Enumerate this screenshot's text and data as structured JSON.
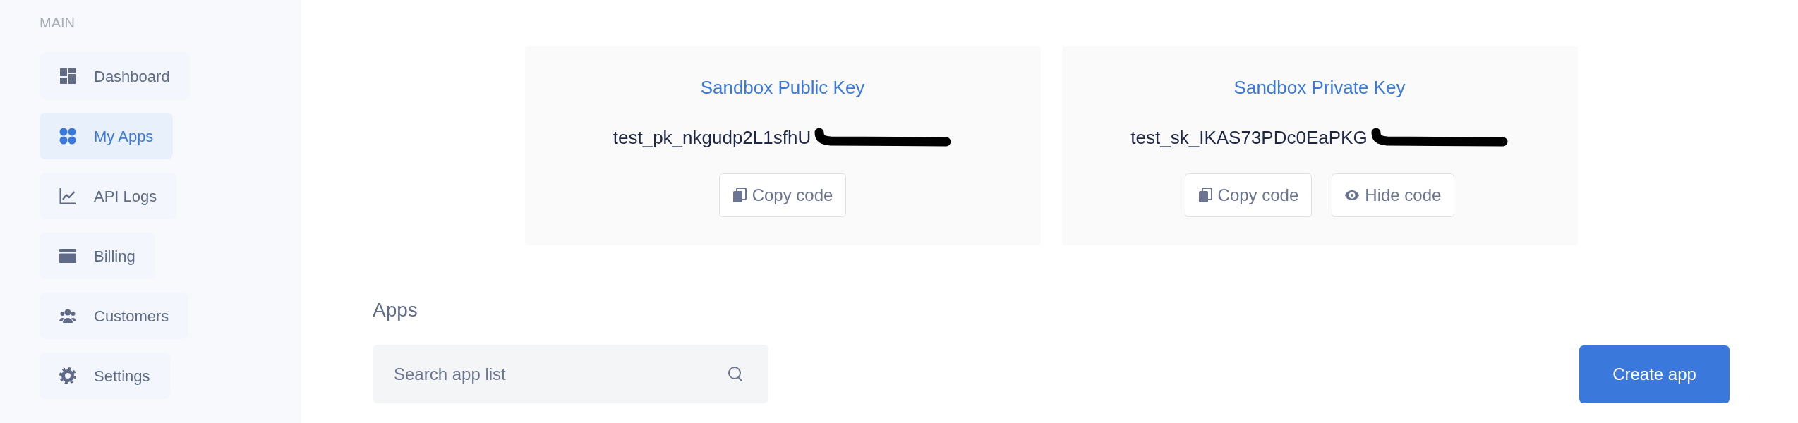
{
  "sidebar": {
    "section_label": "MAIN",
    "items": [
      {
        "kind": "dashboard",
        "label": "Dashboard",
        "selected": false
      },
      {
        "kind": "apps",
        "label": "My Apps",
        "selected": true
      },
      {
        "kind": "logs",
        "label": "API Logs",
        "selected": false
      },
      {
        "kind": "billing",
        "label": "Billing",
        "selected": false
      },
      {
        "kind": "customers",
        "label": "Customers",
        "selected": false
      },
      {
        "kind": "settings",
        "label": "Settings",
        "selected": false
      }
    ]
  },
  "keys": [
    {
      "title": "Sandbox Public Key",
      "value": "test_pk_nkgudp2L1sfhU",
      "redacted": true,
      "buttons": [
        {
          "kind": "copy",
          "label": "Copy code"
        }
      ]
    },
    {
      "title": "Sandbox Private Key",
      "value": "test_sk_IKAS73PDc0EaPKG",
      "redacted": true,
      "buttons": [
        {
          "kind": "copy",
          "label": "Copy code"
        },
        {
          "kind": "hide",
          "label": "Hide code"
        }
      ]
    }
  ],
  "apps": {
    "heading": "Apps",
    "search": {
      "placeholder": "Search app list"
    },
    "create_button": "Create app"
  }
}
